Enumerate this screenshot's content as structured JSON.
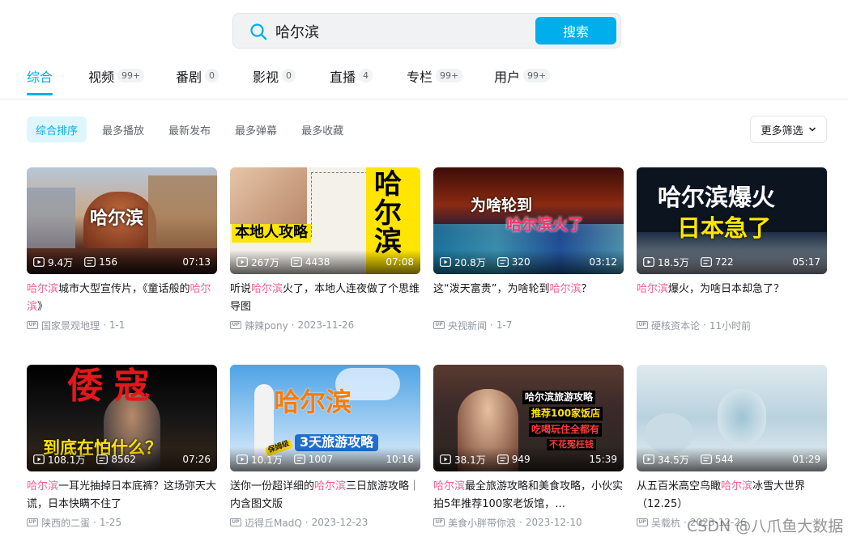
{
  "search": {
    "query": "哈尔滨",
    "button_label": "搜索"
  },
  "tabs": [
    {
      "label": "综合",
      "badge": ""
    },
    {
      "label": "视频",
      "badge": "99+"
    },
    {
      "label": "番剧",
      "badge": "0"
    },
    {
      "label": "影视",
      "badge": "0"
    },
    {
      "label": "直播",
      "badge": "4"
    },
    {
      "label": "专栏",
      "badge": "99+"
    },
    {
      "label": "用户",
      "badge": "99+"
    }
  ],
  "filters": [
    "综合排序",
    "最多播放",
    "最新发布",
    "最多弹幕",
    "最多收藏"
  ],
  "more_filter_label": "更多筛选",
  "videos": [
    {
      "thumb_text": "哈尔滨",
      "views": "9.4万",
      "danmaku": "156",
      "duration": "07:13",
      "title_parts": [
        {
          "t": "哈尔滨",
          "hl": true
        },
        {
          "t": "城市大型宣传片，《童话般的",
          "hl": false
        },
        {
          "t": "哈尔滨",
          "hl": true
        },
        {
          "t": "》",
          "hl": false
        }
      ],
      "author": "国家景观地理",
      "date": "1-1"
    },
    {
      "thumb_text": "本地人攻略",
      "thumb_text_2": "哈尔滨",
      "views": "267万",
      "danmaku": "4438",
      "duration": "07:08",
      "title_parts": [
        {
          "t": "听说",
          "hl": false
        },
        {
          "t": "哈尔滨",
          "hl": true
        },
        {
          "t": "火了，本地人连夜做了个思维导图",
          "hl": false
        }
      ],
      "author": "辣辣pony",
      "date": "2023-11-26"
    },
    {
      "thumb_text": "为啥轮到",
      "thumb_text_2": "哈尔滨火了",
      "views": "20.8万",
      "danmaku": "320",
      "duration": "03:12",
      "title_parts": [
        {
          "t": "这“泼天富贵”，为啥轮到",
          "hl": false
        },
        {
          "t": "哈尔滨",
          "hl": true
        },
        {
          "t": "？",
          "hl": false
        }
      ],
      "author": "央视新闻",
      "date": "1-7"
    },
    {
      "thumb_text": "哈尔滨爆火",
      "thumb_text_2": "日本急了",
      "views": "18.5万",
      "danmaku": "722",
      "duration": "05:17",
      "title_parts": [
        {
          "t": "哈尔滨",
          "hl": true
        },
        {
          "t": "爆火，为啥日本却急了？",
          "hl": false
        }
      ],
      "author": "硬核资本论",
      "date": "11小时前"
    },
    {
      "thumb_text": "倭寇",
      "thumb_text_2": "到底在怕什么？",
      "views": "108.1万",
      "danmaku": "8562",
      "duration": "07:26",
      "title_parts": [
        {
          "t": "哈尔滨",
          "hl": true
        },
        {
          "t": "一耳光抽掉日本底裤？这场弥天大谎，日本快瞒不住了",
          "hl": false
        }
      ],
      "author": "陕西的二蛋",
      "date": "1-25"
    },
    {
      "thumb_text": "哈尔滨",
      "thumb_text_2": "3天旅游攻略",
      "thumb_badge": "保姆级",
      "views": "10.1万",
      "danmaku": "1007",
      "duration": "10:16",
      "title_parts": [
        {
          "t": "送你一份超详细的",
          "hl": false
        },
        {
          "t": "哈尔滨",
          "hl": true
        },
        {
          "t": "三日旅游攻略｜内含图文版",
          "hl": false
        }
      ],
      "author": "迈得丘MadQ",
      "date": "2023-12-23"
    },
    {
      "thumb_text": "哈尔滨旅游攻略",
      "thumb_text_2": "推荐100家饭店",
      "thumb_text_3": "吃喝玩住全都有",
      "thumb_text_4": "不花冤枉钱",
      "views": "38.1万",
      "danmaku": "949",
      "duration": "15:39",
      "title_parts": [
        {
          "t": "哈尔滨",
          "hl": true
        },
        {
          "t": "最全旅游攻略和美食攻略，小伙实拍5年推荐100家老饭馆，…",
          "hl": false
        }
      ],
      "author": "美食小胖带你浪",
      "date": "2023-12-10"
    },
    {
      "views": "34.5万",
      "danmaku": "544",
      "duration": "01:29",
      "title_parts": [
        {
          "t": "从五百米高空鸟瞰",
          "hl": false
        },
        {
          "t": "哈尔滨",
          "hl": true
        },
        {
          "t": "冰雪大世界（12.25）",
          "hl": false
        }
      ],
      "author": "吴载杭",
      "date": "2023-12-26"
    }
  ],
  "watermark": "CSDN @八爪鱼大数据",
  "colors": {
    "accent": "#00aeec",
    "highlight": "#f25d8e"
  }
}
